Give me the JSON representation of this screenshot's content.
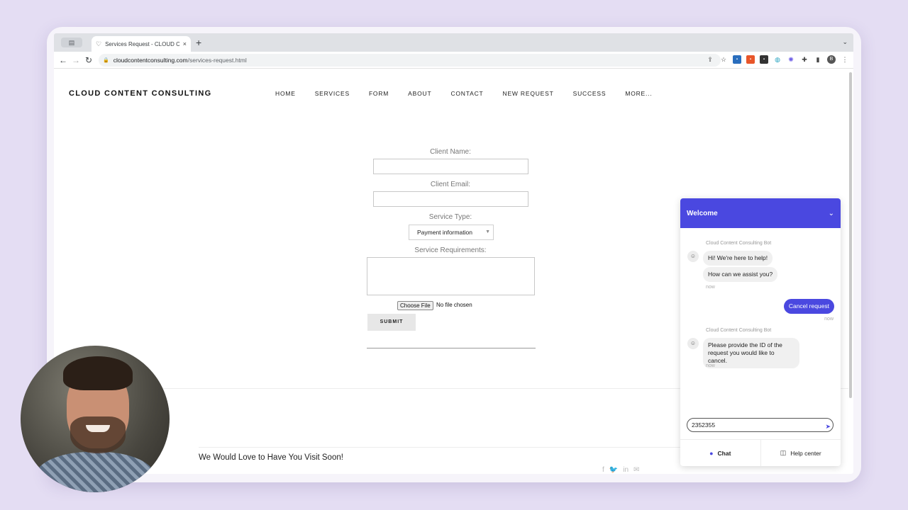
{
  "browser": {
    "tab_title": "Services Request - CLOUD CONTENT CONSULTING",
    "tab_close": "×",
    "new_tab": "+",
    "url_domain": "cloudcontentconsulting.com",
    "url_path": "/services-request.html",
    "profile_initial": "B"
  },
  "site": {
    "logo": "CLOUD CONTENT CONSULTING",
    "nav": [
      "HOME",
      "SERVICES",
      "FORM",
      "ABOUT",
      "CONTACT",
      "NEW REQUEST",
      "SUCCESS",
      "MORE..."
    ]
  },
  "form": {
    "client_name_label": "Client Name:",
    "client_email_label": "Client Email:",
    "service_type_label": "Service Type:",
    "service_type_value": "Payment information",
    "requirements_label": "Service Requirements:",
    "file_button": "Choose File",
    "file_status": "No file chosen",
    "submit": "SUBMIT"
  },
  "footer": {
    "visit_text": "We Would Love to Have You Visit Soon!"
  },
  "chat": {
    "header_title": "Welcome",
    "bot_name": "Cloud Content Consulting Bot",
    "messages": [
      {
        "from": "bot",
        "text": "Hi! We're here to help!"
      },
      {
        "from": "bot",
        "text": "How can we assist you?"
      },
      {
        "from": "user",
        "text": "Cancel request"
      },
      {
        "from": "bot",
        "text": "Please provide the ID of the request you would like to cancel."
      }
    ],
    "time_label": "now",
    "input_value": "2352355",
    "tab_chat": "Chat",
    "tab_help": "Help center",
    "accent_color": "#4a48e0"
  }
}
